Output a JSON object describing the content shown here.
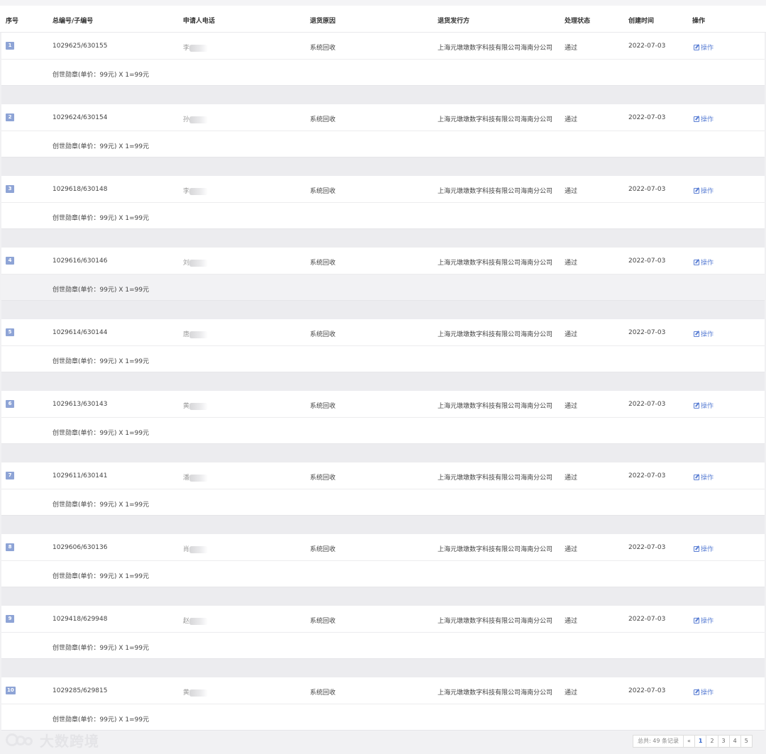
{
  "table": {
    "headers": [
      "序号",
      "总编号/子编号",
      "申请人电话",
      "退货原因",
      "退货发行方",
      "处理状态",
      "创建时间",
      "操作"
    ],
    "rows": [
      {
        "index": "1",
        "order_no": "1029625/630155",
        "applicant": "李",
        "reason": "系统回收",
        "issuer": "上海元墩墩数字科技有限公司海南分公司",
        "status": "通过",
        "created": "2022-07-03",
        "action": "操作",
        "item": "创世勋章(单价：99元) X 1=99元"
      },
      {
        "index": "2",
        "order_no": "1029624/630154",
        "applicant": "孙",
        "reason": "系统回收",
        "issuer": "上海元墩墩数字科技有限公司海南分公司",
        "status": "通过",
        "created": "2022-07-03",
        "action": "操作",
        "item": "创世勋章(单价：99元) X 1=99元"
      },
      {
        "index": "3",
        "order_no": "1029618/630148",
        "applicant": "李",
        "reason": "系统回收",
        "issuer": "上海元墩墩数字科技有限公司海南分公司",
        "status": "通过",
        "created": "2022-07-03",
        "action": "操作",
        "item": "创世勋章(单价：99元) X 1=99元"
      },
      {
        "index": "4",
        "order_no": "1029616/630146",
        "applicant": "刘",
        "reason": "系统回收",
        "issuer": "上海元墩墩数字科技有限公司海南分公司",
        "status": "通过",
        "created": "2022-07-03",
        "action": "操作",
        "item": "创世勋章(单价：99元) X 1=99元"
      },
      {
        "index": "5",
        "order_no": "1029614/630144",
        "applicant": "唐",
        "reason": "系统回收",
        "issuer": "上海元墩墩数字科技有限公司海南分公司",
        "status": "通过",
        "created": "2022-07-03",
        "action": "操作",
        "item": "创世勋章(单价：99元) X 1=99元"
      },
      {
        "index": "6",
        "order_no": "1029613/630143",
        "applicant": "黄",
        "reason": "系统回收",
        "issuer": "上海元墩墩数字科技有限公司海南分公司",
        "status": "通过",
        "created": "2022-07-03",
        "action": "操作",
        "item": "创世勋章(单价：99元) X 1=99元"
      },
      {
        "index": "7",
        "order_no": "1029611/630141",
        "applicant": "潘",
        "reason": "系统回收",
        "issuer": "上海元墩墩数字科技有限公司海南分公司",
        "status": "通过",
        "created": "2022-07-03",
        "action": "操作",
        "item": "创世勋章(单价：99元) X 1=99元"
      },
      {
        "index": "8",
        "order_no": "1029606/630136",
        "applicant": "肖",
        "reason": "系统回收",
        "issuer": "上海元墩墩数字科技有限公司海南分公司",
        "status": "通过",
        "created": "2022-07-03",
        "action": "操作",
        "item": "创世勋章(单价：99元) X 1=99元"
      },
      {
        "index": "9",
        "order_no": "1029418/629948",
        "applicant": "赵",
        "reason": "系统回收",
        "issuer": "上海元墩墩数字科技有限公司海南分公司",
        "status": "通过",
        "created": "2022-07-03",
        "action": "操作",
        "item": "创世勋章(单价：99元) X 1=99元"
      },
      {
        "index": "10",
        "order_no": "1029285/629815",
        "applicant": "黄",
        "reason": "系统回收",
        "issuer": "上海元墩墩数字科技有限公司海南分公司",
        "status": "通过",
        "created": "2022-07-03",
        "action": "操作",
        "item": "创世勋章(单价：99元) X 1=99元"
      }
    ]
  },
  "pagination": {
    "total_text": "总共: 49 条记录",
    "prev": "«",
    "pages": [
      "1",
      "2",
      "3",
      "4",
      "5"
    ],
    "current": "1"
  },
  "watermark": {
    "text": "大数跨境"
  },
  "colors": {
    "index_badge": "#8ea4d6",
    "link": "#5b7fd4",
    "gap_row": "#ececef"
  }
}
